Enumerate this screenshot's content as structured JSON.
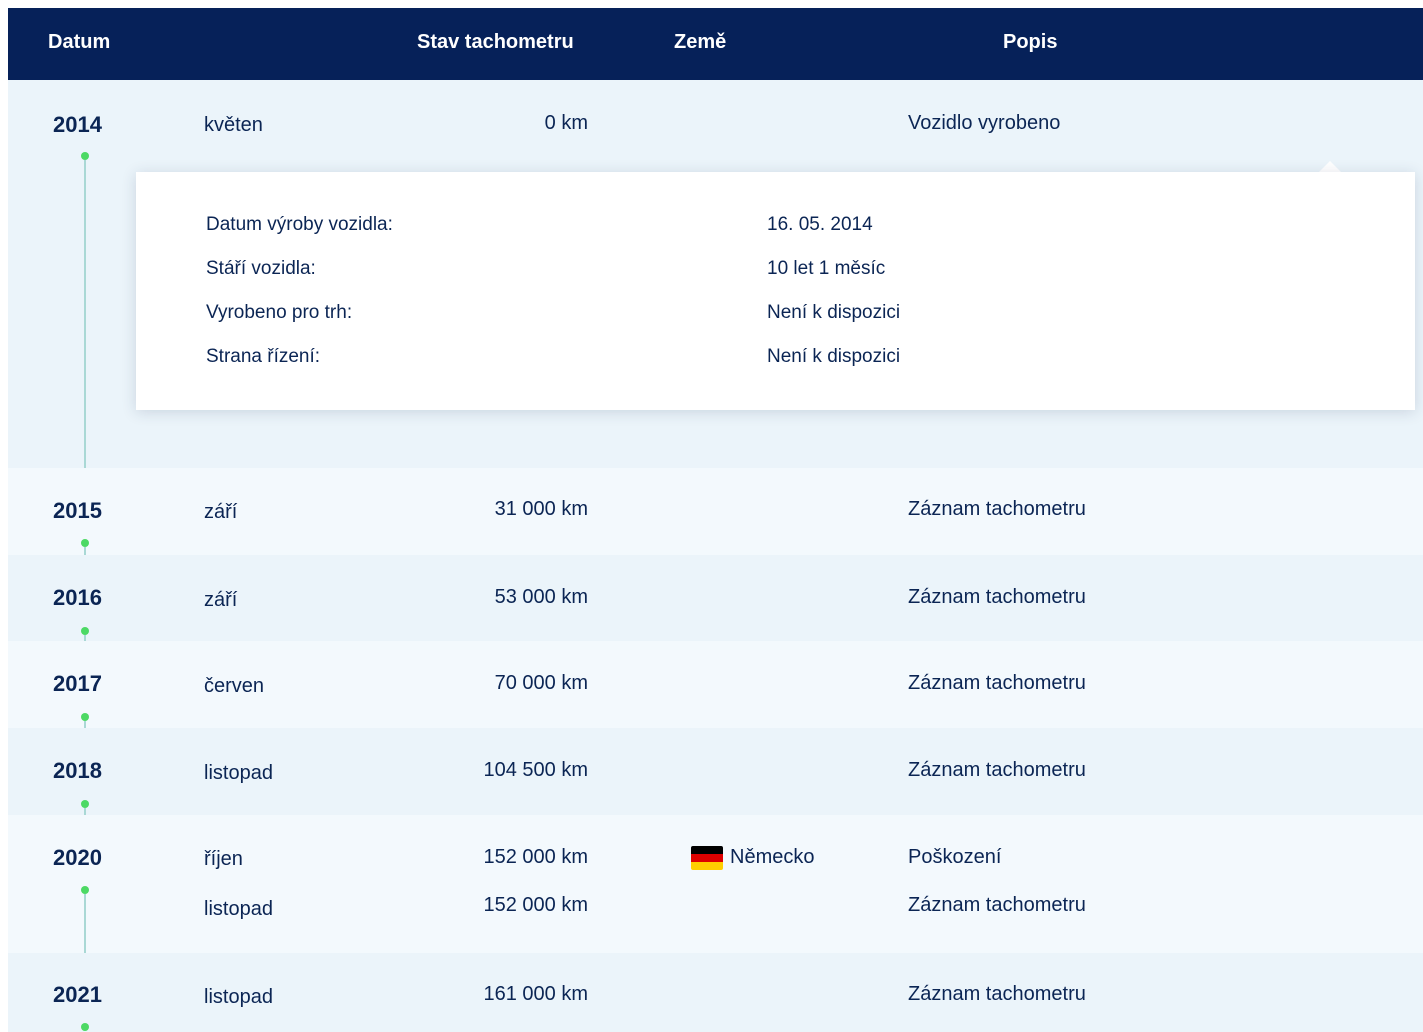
{
  "header": {
    "col_date": "Datum",
    "col_odometer": "Stav tachometru",
    "col_country": "Země",
    "col_description": "Popis"
  },
  "rows": [
    {
      "year": "2014",
      "entries": [
        {
          "month": "květen",
          "km": "0 km",
          "country": "",
          "description": "Vozidlo vyrobeno"
        }
      ]
    },
    {
      "year": "2015",
      "entries": [
        {
          "month": "září",
          "km": "31 000 km",
          "country": "",
          "description": "Záznam tachometru"
        }
      ]
    },
    {
      "year": "2016",
      "entries": [
        {
          "month": "září",
          "km": "53 000 km",
          "country": "",
          "description": "Záznam tachometru"
        }
      ]
    },
    {
      "year": "2017",
      "entries": [
        {
          "month": "červen",
          "km": "70 000 km",
          "country": "",
          "description": "Záznam tachometru"
        }
      ]
    },
    {
      "year": "2018",
      "entries": [
        {
          "month": "listopad",
          "km": "104 500 km",
          "country": "",
          "description": "Záznam tachometru"
        }
      ]
    },
    {
      "year": "2020",
      "entries": [
        {
          "month": "říjen",
          "km": "152 000 km",
          "country": "Německo",
          "description": "Poškození"
        },
        {
          "month": "listopad",
          "km": "152 000 km",
          "country": "",
          "description": "Záznam tachometru"
        }
      ]
    },
    {
      "year": "2021",
      "entries": [
        {
          "month": "listopad",
          "km": "161 000 km",
          "country": "",
          "description": "Záznam tachometru"
        }
      ]
    }
  ],
  "details": {
    "items": [
      {
        "label": "Datum výroby vozidla:",
        "value": "16. 05. 2014"
      },
      {
        "label": "Stáří vozidla:",
        "value": "10 let 1 měsíc"
      },
      {
        "label": "Vyrobeno pro trh:",
        "value": "Není k dispozici"
      },
      {
        "label": "Strana řízení:",
        "value": "Není k dispozici"
      }
    ]
  },
  "colors": {
    "header_bg": "#062159",
    "band_light": "#f3f9fd",
    "band_alt": "#ebf4fa",
    "text": "#0b2554",
    "dot": "#4cd964",
    "line": "#a9d8d5"
  },
  "icons": {
    "flag": "germany-flag-icon"
  }
}
